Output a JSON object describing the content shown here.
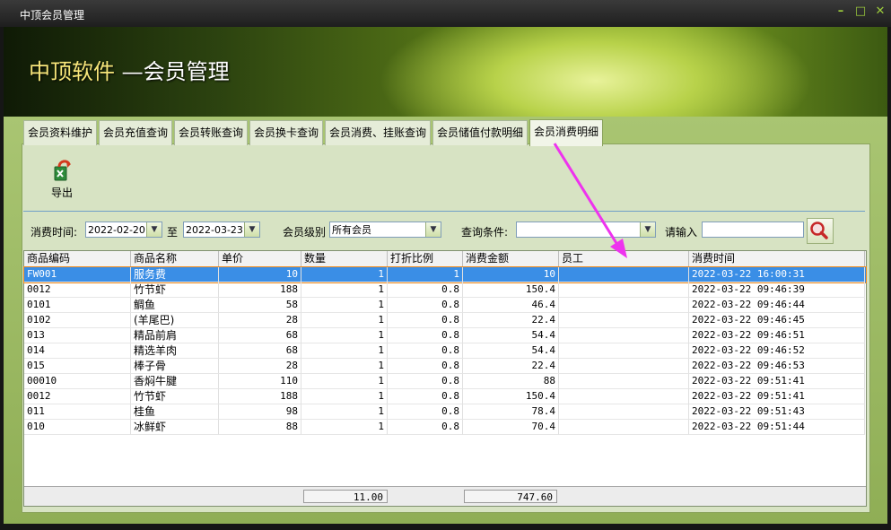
{
  "window": {
    "title": "中顶会员管理"
  },
  "banner": {
    "brand": "中顶软件",
    "subtitle": " —会员管理"
  },
  "tabs": [
    {
      "label": "会员资料维护"
    },
    {
      "label": "会员充值查询"
    },
    {
      "label": "会员转账查询"
    },
    {
      "label": "会员换卡查询"
    },
    {
      "label": "会员消费、挂账查询"
    },
    {
      "label": "会员储值付款明细"
    },
    {
      "label": "会员消费明细",
      "active": true
    }
  ],
  "toolbar": {
    "export_label": "导出"
  },
  "filters": {
    "time_label": "消费时间:",
    "date_from": "2022-02-20",
    "to_label": "至",
    "date_to": "2022-03-23",
    "level_label": "会员级别",
    "level_value": "所有会员",
    "cond_label": "查询条件:",
    "cond_value": "",
    "input_label": "请输入",
    "input_value": ""
  },
  "table": {
    "columns": [
      "商品编码",
      "商品名称",
      "单价",
      "数量",
      "打折比例",
      "消费金额",
      "员工",
      "消费时间"
    ],
    "rows": [
      [
        "FW001",
        "服务费",
        "10",
        "1",
        "1",
        "10",
        "",
        "2022-03-22 16:00:31"
      ],
      [
        "0012",
        "竹节虾",
        "188",
        "1",
        "0.8",
        "150.4",
        "",
        "2022-03-22 09:46:39"
      ],
      [
        "0101",
        "鲷鱼",
        "58",
        "1",
        "0.8",
        "46.4",
        "",
        "2022-03-22 09:46:44"
      ],
      [
        "0102",
        "(羊尾巴)",
        "28",
        "1",
        "0.8",
        "22.4",
        "",
        "2022-03-22 09:46:45"
      ],
      [
        "013",
        "精品前肩",
        "68",
        "1",
        "0.8",
        "54.4",
        "",
        "2022-03-22 09:46:51"
      ],
      [
        "014",
        "精选羊肉",
        "68",
        "1",
        "0.8",
        "54.4",
        "",
        "2022-03-22 09:46:52"
      ],
      [
        "015",
        "棒子骨",
        "28",
        "1",
        "0.8",
        "22.4",
        "",
        "2022-03-22 09:46:53"
      ],
      [
        "00010",
        "香焖牛腱",
        "110",
        "1",
        "0.8",
        "88",
        "",
        "2022-03-22 09:51:41"
      ],
      [
        "0012",
        "竹节虾",
        "188",
        "1",
        "0.8",
        "150.4",
        "",
        "2022-03-22 09:51:41"
      ],
      [
        "011",
        "桂鱼",
        "98",
        "1",
        "0.8",
        "78.4",
        "",
        "2022-03-22 09:51:43"
      ],
      [
        "010",
        "冰鲜虾",
        "88",
        "1",
        "0.8",
        "70.4",
        "",
        "2022-03-22 09:51:44"
      ]
    ],
    "selected_row": 0,
    "total_qty": "11.00",
    "total_amount": "747.60"
  },
  "colors": {
    "selected_row": "#3a8ee6",
    "annotation_arrow": "#ee33ee"
  },
  "icons": {
    "export": "export-icon",
    "search": "search-icon"
  }
}
